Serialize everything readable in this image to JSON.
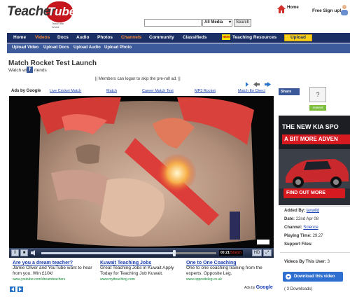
{
  "header": {
    "logo_text_a": "Teacher",
    "logo_text_b": "Tube",
    "logo_tagline": "Teach the World",
    "home_label": "Home",
    "signup_label": "Free Sign up!",
    "search_placeholder": "",
    "search_select": "All Media",
    "search_button": "Search"
  },
  "nav": {
    "items": [
      "Home",
      "Videos",
      "Docs",
      "Audio",
      "Photos",
      "Channels",
      "Community",
      "Classifieds",
      "Teaching Resources"
    ],
    "new_badge": "NEW",
    "upload": "Upload"
  },
  "subnav": {
    "items": [
      "Upload Video",
      "Upload Docs",
      "Upload Audio",
      "Upload Photo"
    ]
  },
  "video": {
    "title": "Match Rocket Test Launch",
    "watch_with": "Watch w/",
    "friends": "riends",
    "members_notice": "|| Members can logon to skip the pre-roll ad. ||",
    "player": {
      "time_current": "00:21",
      "time_total": "Stretch",
      "hd_label": "HD",
      "progress": 0.76
    }
  },
  "ads_top": {
    "label": "Ads by Google",
    "links": [
      "Live Cricket Match",
      "Match",
      "Career Match Test",
      "MP3 Rocket",
      "Match En Direct"
    ]
  },
  "ads_bottom": [
    {
      "headline": "Are you a dream teacher?",
      "body": "Jamie Oliver and YouTube want to hear from you. Win £10k!",
      "url": "www.youtube.com/dreamteachers"
    },
    {
      "headline": "Kuwait Teaching Jobs",
      "body": "Great Teaching Jobs in Kuwait Apply Today for Teaching Job Kuwait.",
      "url": "www.mytteaching.com"
    },
    {
      "headline": "One to One Coaching",
      "body": "One to one coaching training from the experts. Opposite Leg.",
      "url": "www.oppositeleg.co.uk"
    }
  ],
  "ads_bottom_label_a": "Ads by",
  "ads_bottom_label_b": "Google",
  "sidebar": {
    "share": "Share",
    "thumb": "?",
    "retweet": "retweet",
    "kia_line1": "THE NEW KIA SPO",
    "kia_line2": "A BIT MORE ADVEN",
    "kia_cta": "FIND OUT MORE",
    "added_by_label": "Added By:",
    "added_by": "lanwild",
    "date_label": "Date:",
    "date": "22nd Apr 08",
    "channel_label": "Channel:",
    "channel": "Science",
    "playing_label": "Playing Time:",
    "playing": "29.27",
    "support_label": "Support Files:",
    "by_user_label": "Videos By This User:",
    "by_user": "3",
    "download": "Download this video",
    "downloads_count": "( 3 Downloads)"
  },
  "colors": {
    "nav_bg": "#1b2f64",
    "subnav_bg": "#3d5a9a",
    "upload_btn": "#f8cf1b",
    "accent_red": "#c4161c",
    "link": "#1a3fb3"
  }
}
